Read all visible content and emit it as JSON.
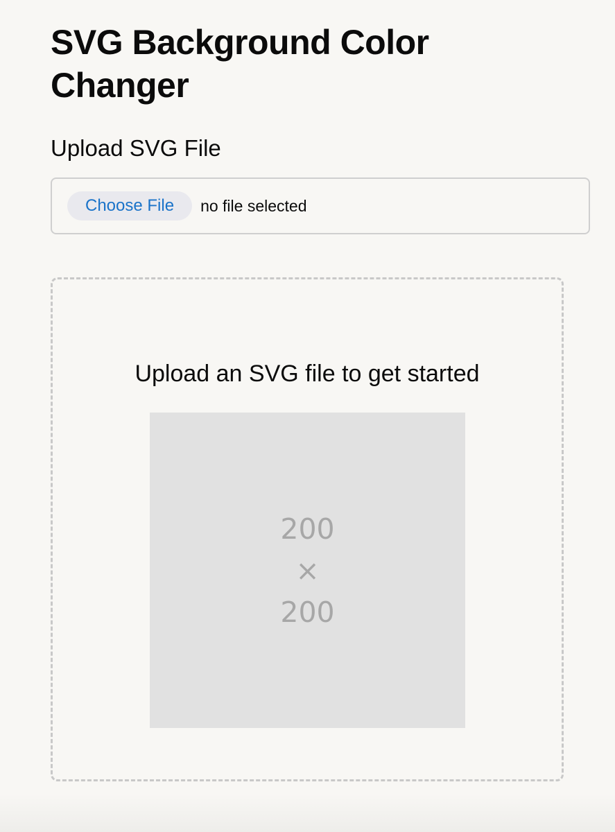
{
  "header": {
    "title": "SVG Background Color Changer"
  },
  "upload": {
    "label": "Upload SVG File",
    "button_label": "Choose File",
    "status": "no file selected"
  },
  "preview": {
    "prompt": "Upload an SVG file to get started",
    "placeholder": {
      "width_text": "200",
      "separator": "×",
      "height_text": "200"
    }
  },
  "colors": {
    "background": "#f8f7f4",
    "button_text": "#1a73c9",
    "button_background": "#e9e9ee",
    "border": "#cfcfcf",
    "placeholder_background": "#e1e1e1",
    "placeholder_text": "#a7a7a7"
  }
}
